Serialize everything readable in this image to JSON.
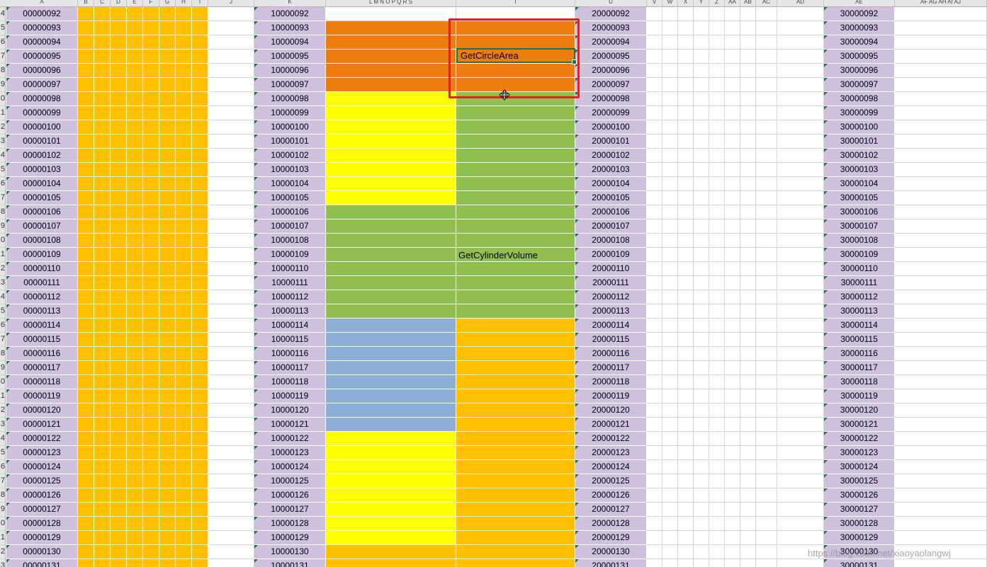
{
  "app": {
    "name": "Excel worksheet"
  },
  "columns": [
    {
      "key": "A",
      "label": "A",
      "fill": "#cdc1dd",
      "text": "a"
    },
    {
      "key": "B",
      "label": "B",
      "fill": "#ffc000"
    },
    {
      "key": "C",
      "label": "C",
      "fill": "#ffc000"
    },
    {
      "key": "D",
      "label": "D",
      "fill": "#ffc000"
    },
    {
      "key": "E",
      "label": "E",
      "fill": "#ffc000"
    },
    {
      "key": "F",
      "label": "F",
      "fill": "#ffc000"
    },
    {
      "key": "G",
      "label": "G",
      "fill": "#ffc000"
    },
    {
      "key": "H",
      "label": "H",
      "fill": "#ffc000"
    },
    {
      "key": "I",
      "label": "I",
      "fill": "#ffc000"
    },
    {
      "key": "J",
      "label": "J",
      "fill": "#ffffff"
    },
    {
      "key": "K",
      "label": "K",
      "fill": "#cdc1dd",
      "text": "k"
    },
    {
      "key": "LS",
      "label": "L  M  N  O  P  Q  R  S",
      "fill": "band:left"
    },
    {
      "key": "T",
      "label": "T",
      "fill": "band:right"
    },
    {
      "key": "U",
      "label": "U",
      "fill": "#cdc1dd",
      "text": "u"
    },
    {
      "key": "V",
      "label": "V",
      "fill": "#ffffff"
    },
    {
      "key": "W",
      "label": "W",
      "fill": "#ffffff"
    },
    {
      "key": "X",
      "label": "X",
      "fill": "#ffffff"
    },
    {
      "key": "Y",
      "label": "Y",
      "fill": "#ffffff"
    },
    {
      "key": "Z",
      "label": "Z",
      "fill": "#ffffff"
    },
    {
      "key": "AA",
      "label": "AA",
      "fill": "#ffffff"
    },
    {
      "key": "AB",
      "label": "AB",
      "fill": "#ffffff"
    },
    {
      "key": "AC",
      "label": "AC",
      "fill": "#ffffff"
    },
    {
      "key": "AD",
      "label": "AD",
      "fill": "#ffffff"
    },
    {
      "key": "AE",
      "label": "AE",
      "fill": "#cdc1dd",
      "text": "ae"
    },
    {
      "key": "AF",
      "label": "AF AG AH AI AJ",
      "fill": "#ffffff"
    }
  ],
  "rows": [
    {
      "n": "4",
      "a": "00000092",
      "k": "10000092",
      "u": "20000092",
      "ae": "30000092"
    },
    {
      "n": "5",
      "a": "00000093",
      "k": "10000093",
      "u": "20000093",
      "ae": "30000093"
    },
    {
      "n": "6",
      "a": "00000094",
      "k": "10000094",
      "u": "20000094",
      "ae": "30000094"
    },
    {
      "n": "7",
      "a": "00000095",
      "k": "10000095",
      "u": "20000095",
      "ae": "30000095"
    },
    {
      "n": "8",
      "a": "00000096",
      "k": "10000096",
      "u": "20000096",
      "ae": "30000096"
    },
    {
      "n": "9",
      "a": "00000097",
      "k": "10000097",
      "u": "20000097",
      "ae": "30000097"
    },
    {
      "n": "0",
      "a": "00000098",
      "k": "10000098",
      "u": "20000098",
      "ae": "30000098"
    },
    {
      "n": "1",
      "a": "00000099",
      "k": "10000099",
      "u": "20000099",
      "ae": "30000099"
    },
    {
      "n": "2",
      "a": "00000100",
      "k": "10000100",
      "u": "20000100",
      "ae": "30000100"
    },
    {
      "n": "3",
      "a": "00000101",
      "k": "10000101",
      "u": "20000101",
      "ae": "30000101"
    },
    {
      "n": "4",
      "a": "00000102",
      "k": "10000102",
      "u": "20000102",
      "ae": "30000102"
    },
    {
      "n": "5",
      "a": "00000103",
      "k": "10000103",
      "u": "20000103",
      "ae": "30000103"
    },
    {
      "n": "6",
      "a": "00000104",
      "k": "10000104",
      "u": "20000104",
      "ae": "30000104"
    },
    {
      "n": "7",
      "a": "00000105",
      "k": "10000105",
      "u": "20000105",
      "ae": "30000105"
    },
    {
      "n": "8",
      "a": "00000106",
      "k": "10000106",
      "u": "20000106",
      "ae": "30000106"
    },
    {
      "n": "9",
      "a": "00000107",
      "k": "10000107",
      "u": "20000107",
      "ae": "30000107"
    },
    {
      "n": "0",
      "a": "00000108",
      "k": "10000108",
      "u": "20000108",
      "ae": "30000108"
    },
    {
      "n": "1",
      "a": "00000109",
      "k": "10000109",
      "u": "20000109",
      "ae": "30000109"
    },
    {
      "n": "2",
      "a": "00000110",
      "k": "10000110",
      "u": "20000110",
      "ae": "30000110"
    },
    {
      "n": "3",
      "a": "00000111",
      "k": "10000111",
      "u": "20000111",
      "ae": "30000111"
    },
    {
      "n": "4",
      "a": "00000112",
      "k": "10000112",
      "u": "20000112",
      "ae": "30000112"
    },
    {
      "n": "5",
      "a": "00000113",
      "k": "10000113",
      "u": "20000113",
      "ae": "30000113"
    },
    {
      "n": "6",
      "a": "00000114",
      "k": "10000114",
      "u": "20000114",
      "ae": "30000114"
    },
    {
      "n": "7",
      "a": "00000115",
      "k": "10000115",
      "u": "20000115",
      "ae": "30000115"
    },
    {
      "n": "8",
      "a": "00000116",
      "k": "10000116",
      "u": "20000116",
      "ae": "30000116"
    },
    {
      "n": "9",
      "a": "00000117",
      "k": "10000117",
      "u": "20000117",
      "ae": "30000117"
    },
    {
      "n": "0",
      "a": "00000118",
      "k": "10000118",
      "u": "20000118",
      "ae": "30000118"
    },
    {
      "n": "1",
      "a": "00000119",
      "k": "10000119",
      "u": "20000119",
      "ae": "30000119"
    },
    {
      "n": "2",
      "a": "00000120",
      "k": "10000120",
      "u": "20000120",
      "ae": "30000120"
    },
    {
      "n": "3",
      "a": "00000121",
      "k": "10000121",
      "u": "20000121",
      "ae": "30000121"
    },
    {
      "n": "4",
      "a": "00000122",
      "k": "10000122",
      "u": "20000122",
      "ae": "30000122"
    },
    {
      "n": "5",
      "a": "00000123",
      "k": "10000123",
      "u": "20000123",
      "ae": "30000123"
    },
    {
      "n": "6",
      "a": "00000124",
      "k": "10000124",
      "u": "20000124",
      "ae": "30000124"
    },
    {
      "n": "7",
      "a": "00000125",
      "k": "10000125",
      "u": "20000125",
      "ae": "30000125"
    },
    {
      "n": "8",
      "a": "00000126",
      "k": "10000126",
      "u": "20000126",
      "ae": "30000126"
    },
    {
      "n": "9",
      "a": "00000127",
      "k": "10000127",
      "u": "20000127",
      "ae": "30000127"
    },
    {
      "n": "0",
      "a": "00000128",
      "k": "10000128",
      "u": "20000128",
      "ae": "30000128"
    },
    {
      "n": "1",
      "a": "00000129",
      "k": "10000129",
      "u": "20000129",
      "ae": "30000129"
    },
    {
      "n": "2",
      "a": "00000130",
      "k": "10000130",
      "u": "20000130",
      "ae": "30000130"
    },
    {
      "n": "3",
      "a": "00000131",
      "k": "10000131",
      "u": "20000131",
      "ae": "30000131"
    }
  ],
  "bands": {
    "left": [
      {
        "from": 0,
        "to": 0,
        "fill": "#ffffff"
      },
      {
        "from": 1,
        "to": 5,
        "fill": "#ed7d0e"
      },
      {
        "from": 6,
        "to": 13,
        "fill": "#ffff00"
      },
      {
        "from": 14,
        "to": 21,
        "fill": "#92c050"
      },
      {
        "from": 22,
        "to": 29,
        "fill": "#8eaed8"
      },
      {
        "from": 30,
        "to": 37,
        "fill": "#ffff00"
      },
      {
        "from": 38,
        "to": 39,
        "fill": "#ffc000"
      }
    ],
    "right": [
      {
        "from": 0,
        "to": 0,
        "fill": "#ffffff"
      },
      {
        "from": 1,
        "to": 5,
        "fill": "#ed7d0e"
      },
      {
        "from": 6,
        "to": 21,
        "fill": "#92c050"
      },
      {
        "from": 22,
        "to": 39,
        "fill": "#ffc000"
      }
    ]
  },
  "cell_texts": {
    "active_cell": "GetCircleArea",
    "volume_cell": "GetCylinderVolume"
  },
  "colors": {
    "selection_border": "#ee1c1c",
    "active_cell_border": "#217346",
    "error_triangle": "#217346"
  },
  "watermark": "https://blog.csdn.net/xiaoyaolangwj"
}
